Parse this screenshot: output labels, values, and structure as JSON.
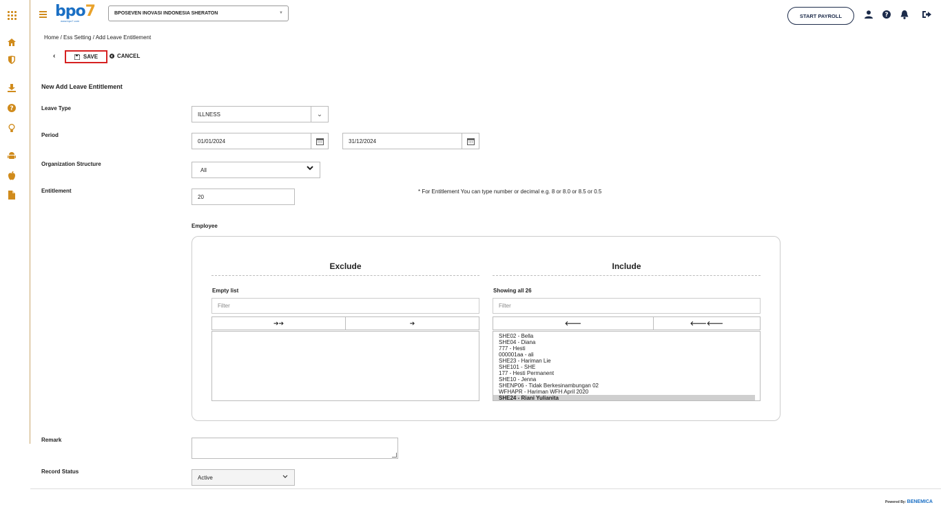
{
  "header": {
    "logo_text": "bpo",
    "logo_seven": "7",
    "logo_tagline": "www.bpo7.com",
    "company_selected": "BPOSEVEN INOVASI INDONESIA SHERATON",
    "start_payroll_label": "START PAYROLL",
    "icons": [
      "user-icon",
      "help-icon",
      "bell-icon",
      "logout-icon"
    ]
  },
  "sidebar": {
    "icons": [
      "apps-icon",
      "home-icon",
      "shield-icon",
      "download-icon",
      "help-icon",
      "lightbulb-icon",
      "android-icon",
      "apple-icon",
      "document-icon"
    ]
  },
  "breadcrumb": "Home / Ess Setting / Add Leave Entitlement",
  "toolbar": {
    "save_label": "SAVE",
    "cancel_label": "CANCEL"
  },
  "form": {
    "title": "New Add Leave Entitlement",
    "leave_type": {
      "label": "Leave Type",
      "value": "ILLNESS"
    },
    "period": {
      "label": "Period",
      "start": "01/01/2024",
      "end": "31/12/2024"
    },
    "org_structure": {
      "label": "Organization Structure",
      "value": "All"
    },
    "entitlement": {
      "label": "Entitlement",
      "value": "20",
      "hint": "* For Entitlement You can type number or decimal e.g. 8 or 8.0 or 8.5 or 0.5"
    },
    "employee_label": "Employee",
    "remark_label": "Remark",
    "record_status": {
      "label": "Record Status",
      "value": "Active"
    }
  },
  "dual_list": {
    "exclude": {
      "title": "Exclude",
      "info": "Empty list",
      "filter_placeholder": "Filter",
      "move_all": "➔➔",
      "move_one": "➔",
      "items": []
    },
    "include": {
      "title": "Include",
      "info": "Showing all 26",
      "filter_placeholder": "Filter",
      "remove_one": "🡐",
      "remove_all": "🡐🡐",
      "items": [
        "SHE02 - Bella",
        "SHE04 - Diana",
        "777 - Hesti",
        "000001aa - ali",
        "SHE23 - Hariman Lie",
        "SHE101 - SHE",
        "177 - Hesti Permanent",
        "SHE10 - Jenna",
        "SHENP06 - Tidak Berkesinambungan 02",
        "WFHAPR - Hariman WFH April 2020",
        "SHE24 - Riani Yulianita"
      ],
      "selected_item": "SHE24 - Riani Yulianita"
    }
  },
  "footer": {
    "powered_by": "Powered By:",
    "brand": "BENEMICA"
  },
  "colors": {
    "accent": "#d08b1c",
    "brand_blue": "#1a6fc4",
    "navy": "#1c2b4a",
    "save_border": "#d62020"
  }
}
